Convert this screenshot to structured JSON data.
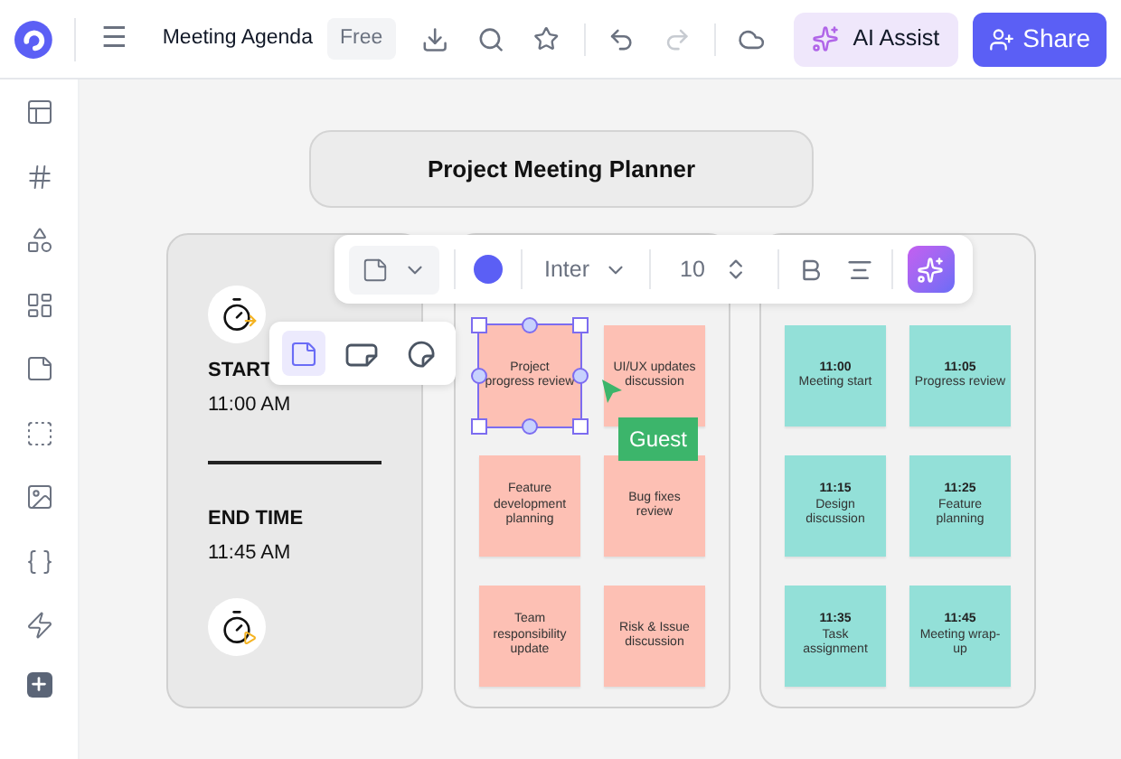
{
  "header": {
    "menu_label": "☰",
    "document_title": "Meeting Agenda",
    "plan_badge": "Free",
    "ai_button": "AI Assist",
    "share_button": "Share"
  },
  "canvas": {
    "title": "Project Meeting Planner",
    "schedule": {
      "start_label": "START",
      "start_time": "11:00 AM",
      "end_label": "END TIME",
      "end_time": "11:45 AM"
    },
    "toolbar": {
      "font": "Inter",
      "font_size": "10"
    },
    "shape_options": [
      {
        "kind": "square",
        "selected": true
      },
      {
        "kind": "wide",
        "selected": false
      },
      {
        "kind": "round",
        "selected": false
      }
    ],
    "topic_notes": [
      {
        "text": "Project progress review",
        "selected": true
      },
      {
        "text": "UI/UX updates discussion",
        "selected": false
      },
      {
        "text": "Feature development planning",
        "selected": false
      },
      {
        "text": "Bug fixes review",
        "selected": false
      },
      {
        "text": "Team responsibility update",
        "selected": false
      },
      {
        "text": "Risk & Issue discussion",
        "selected": false
      }
    ],
    "timeline_notes": [
      {
        "time": "11:00",
        "text": "Meeting start"
      },
      {
        "time": "11:05",
        "text": "Progress review"
      },
      {
        "time": "11:15",
        "text": "Design discussion"
      },
      {
        "time": "11:25",
        "text": "Feature planning"
      },
      {
        "time": "11:35",
        "text": "Task assignment"
      },
      {
        "time": "11:45",
        "text": "Meeting wrap-up"
      }
    ],
    "cursor_label": "Guest"
  }
}
